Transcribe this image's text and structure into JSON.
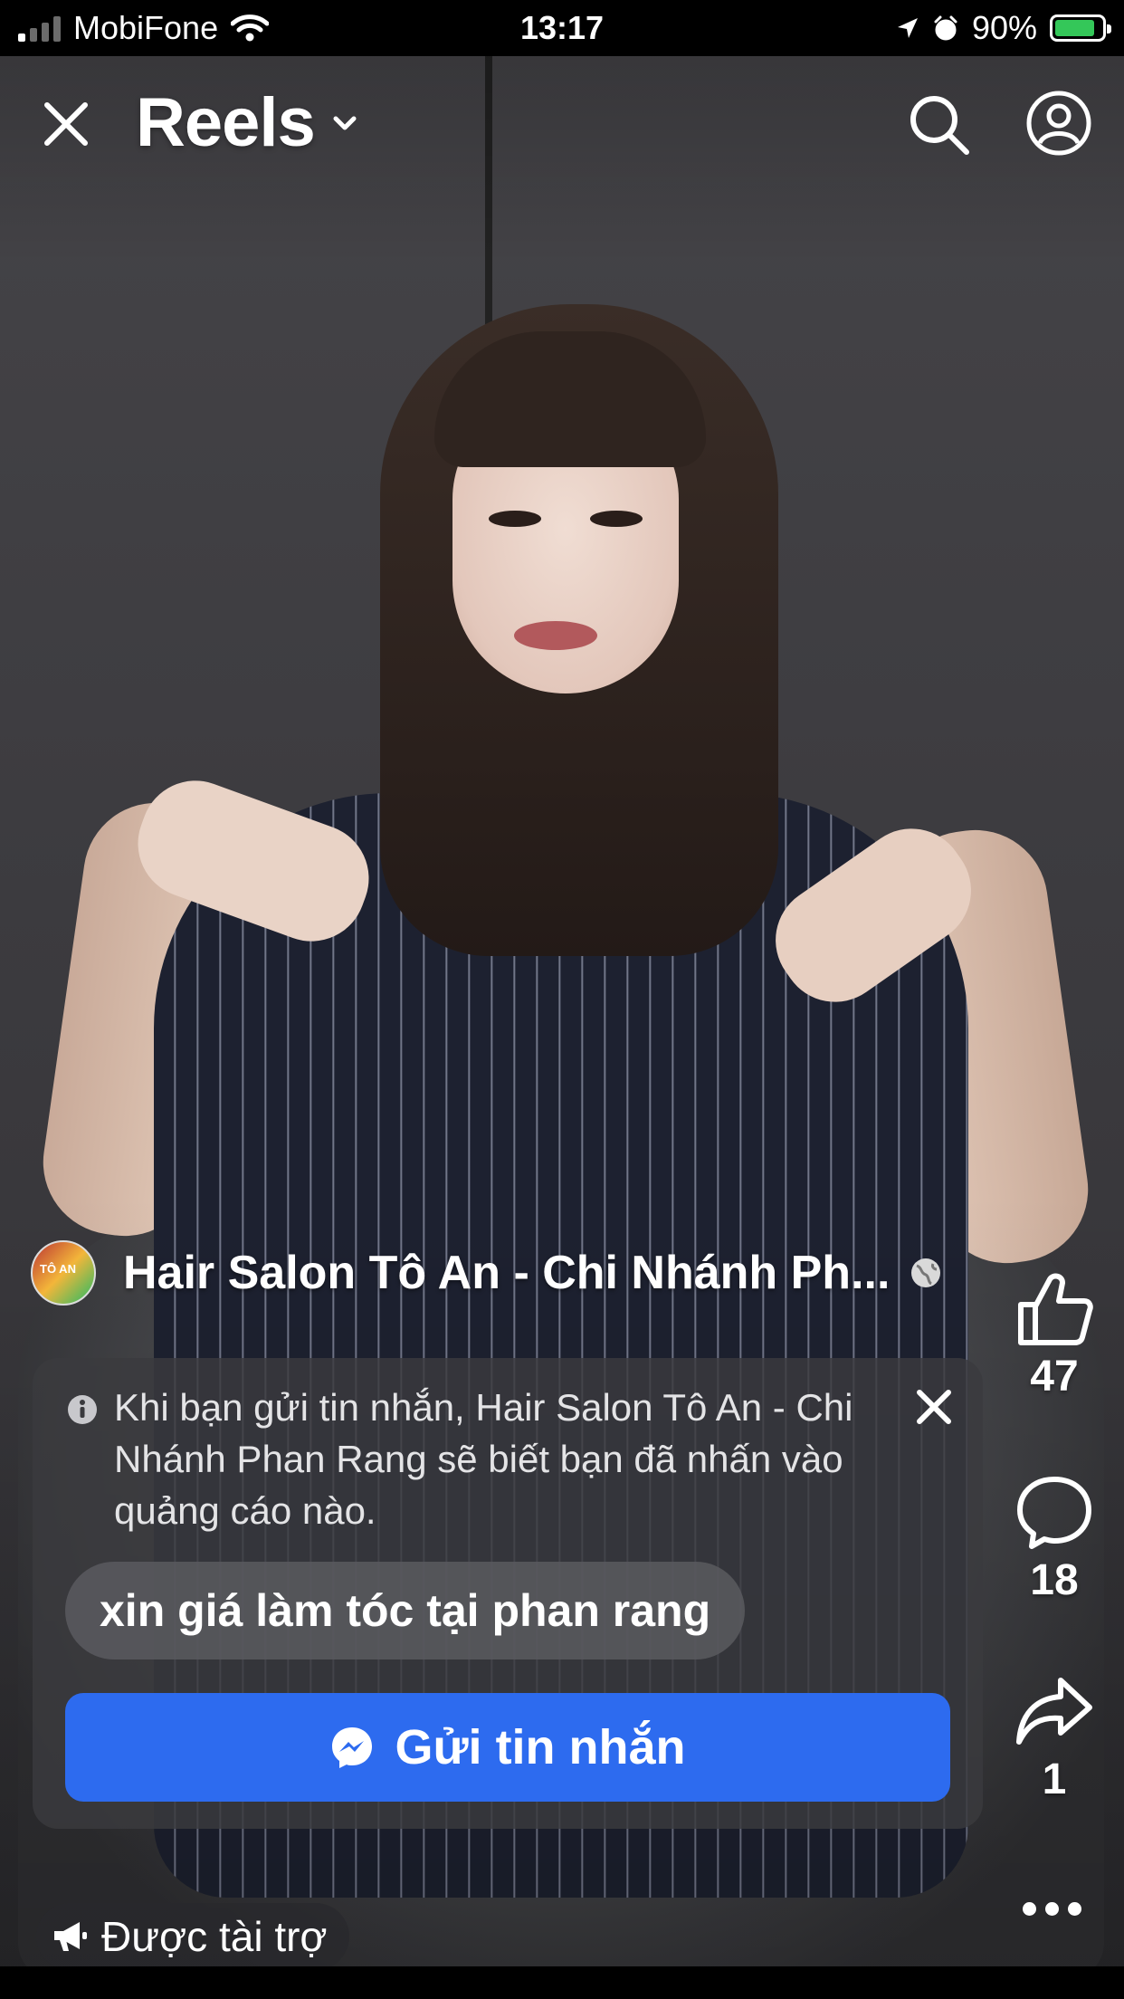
{
  "status_bar": {
    "carrier": "MobiFone",
    "time": "13:17",
    "battery_percent": "90%",
    "battery_level": 0.9,
    "battery_color": "#34c759"
  },
  "header": {
    "title": "Reels",
    "icons": [
      "close-icon",
      "chevron-down-icon",
      "search-icon",
      "profile-icon"
    ]
  },
  "post": {
    "page_name": "Hair Salon Tô An - Chi Nhánh Ph...",
    "audience_icon": "globe-icon"
  },
  "ad_card": {
    "disclaimer": "Khi bạn gửi tin nhắn, Hair Salon Tô An - Chi Nhánh Phan Rang sẽ biết bạn đã nhấn vào quảng cáo nào.",
    "suggested_message": "xin giá làm tóc tại phan rang",
    "send_button": "Gửi tin nhắn",
    "send_button_color": "#2d6bef"
  },
  "actions": {
    "likes": "47",
    "comments": "18",
    "shares": "1"
  },
  "sponsored_label": "Được tài trợ"
}
